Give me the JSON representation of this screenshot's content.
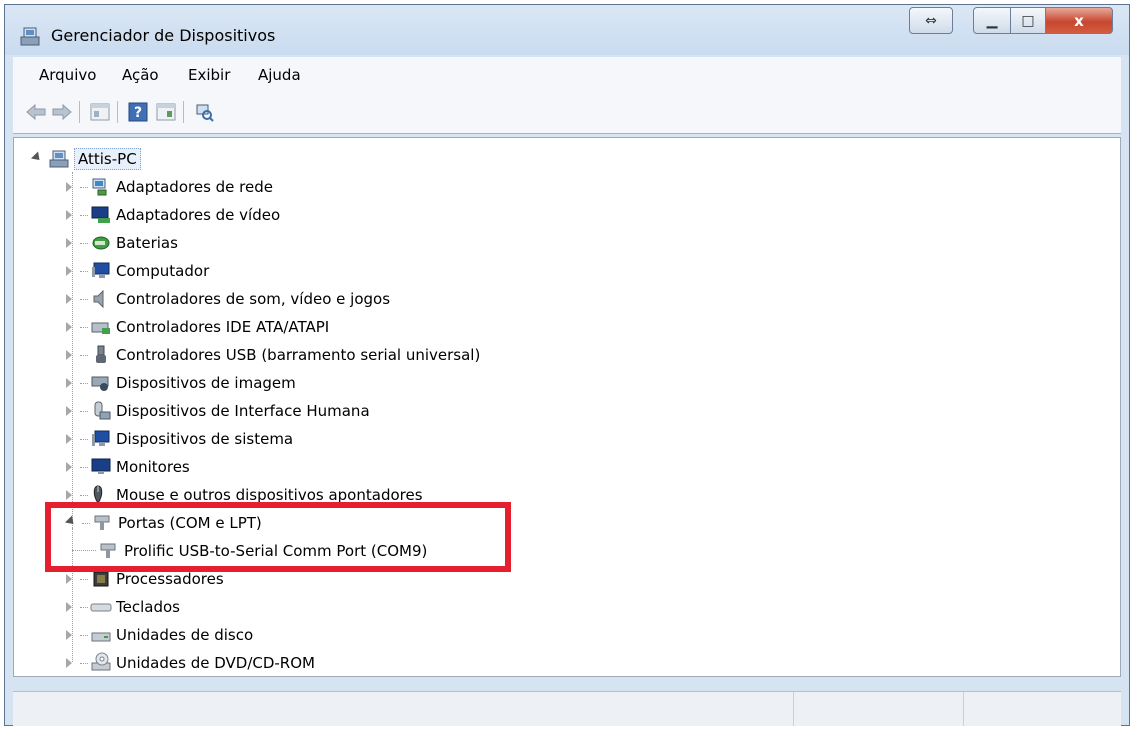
{
  "window": {
    "title": "Gerenciador de Dispositivos",
    "controls": {
      "minimize": "▁",
      "maximize": "□",
      "close": "x",
      "resize": "⇔"
    }
  },
  "menu": [
    "Arquivo",
    "Ação",
    "Exibir",
    "Ajuda"
  ],
  "tree": {
    "root": "Attis-PC",
    "items": [
      {
        "label": "Adaptadores de rede",
        "icon": "network-adapter-icon",
        "expanded": false
      },
      {
        "label": "Adaptadores de vídeo",
        "icon": "display-adapter-icon",
        "expanded": false
      },
      {
        "label": "Baterias",
        "icon": "battery-icon",
        "expanded": false
      },
      {
        "label": "Computador",
        "icon": "computer-icon",
        "expanded": false
      },
      {
        "label": "Controladores de som, vídeo e jogos",
        "icon": "speaker-icon",
        "expanded": false
      },
      {
        "label": "Controladores IDE ATA/ATAPI",
        "icon": "ide-controller-icon",
        "expanded": false
      },
      {
        "label": "Controladores USB (barramento serial universal)",
        "icon": "usb-icon",
        "expanded": false
      },
      {
        "label": "Dispositivos de imagem",
        "icon": "imaging-device-icon",
        "expanded": false
      },
      {
        "label": "Dispositivos de Interface Humana",
        "icon": "hid-icon",
        "expanded": false
      },
      {
        "label": "Dispositivos de sistema",
        "icon": "system-device-icon",
        "expanded": false
      },
      {
        "label": "Monitores",
        "icon": "monitor-icon",
        "expanded": false
      },
      {
        "label": "Mouse e outros dispositivos apontadores",
        "icon": "mouse-icon",
        "expanded": false
      },
      {
        "label": "Portas (COM e LPT)",
        "icon": "port-icon",
        "expanded": true,
        "children": [
          {
            "label": "Prolific USB-to-Serial Comm Port (COM9)",
            "icon": "port-icon"
          }
        ]
      },
      {
        "label": "Processadores",
        "icon": "processor-icon",
        "expanded": false
      },
      {
        "label": "Teclados",
        "icon": "keyboard-icon",
        "expanded": false
      },
      {
        "label": "Unidades de disco",
        "icon": "disk-drive-icon",
        "expanded": false
      },
      {
        "label": "Unidades de DVD/CD-ROM",
        "icon": "dvd-drive-icon",
        "expanded": false
      }
    ]
  },
  "colors": {
    "highlight": "#e4202e",
    "close_button": "#c7472f",
    "selection": "#e8f1fb"
  }
}
